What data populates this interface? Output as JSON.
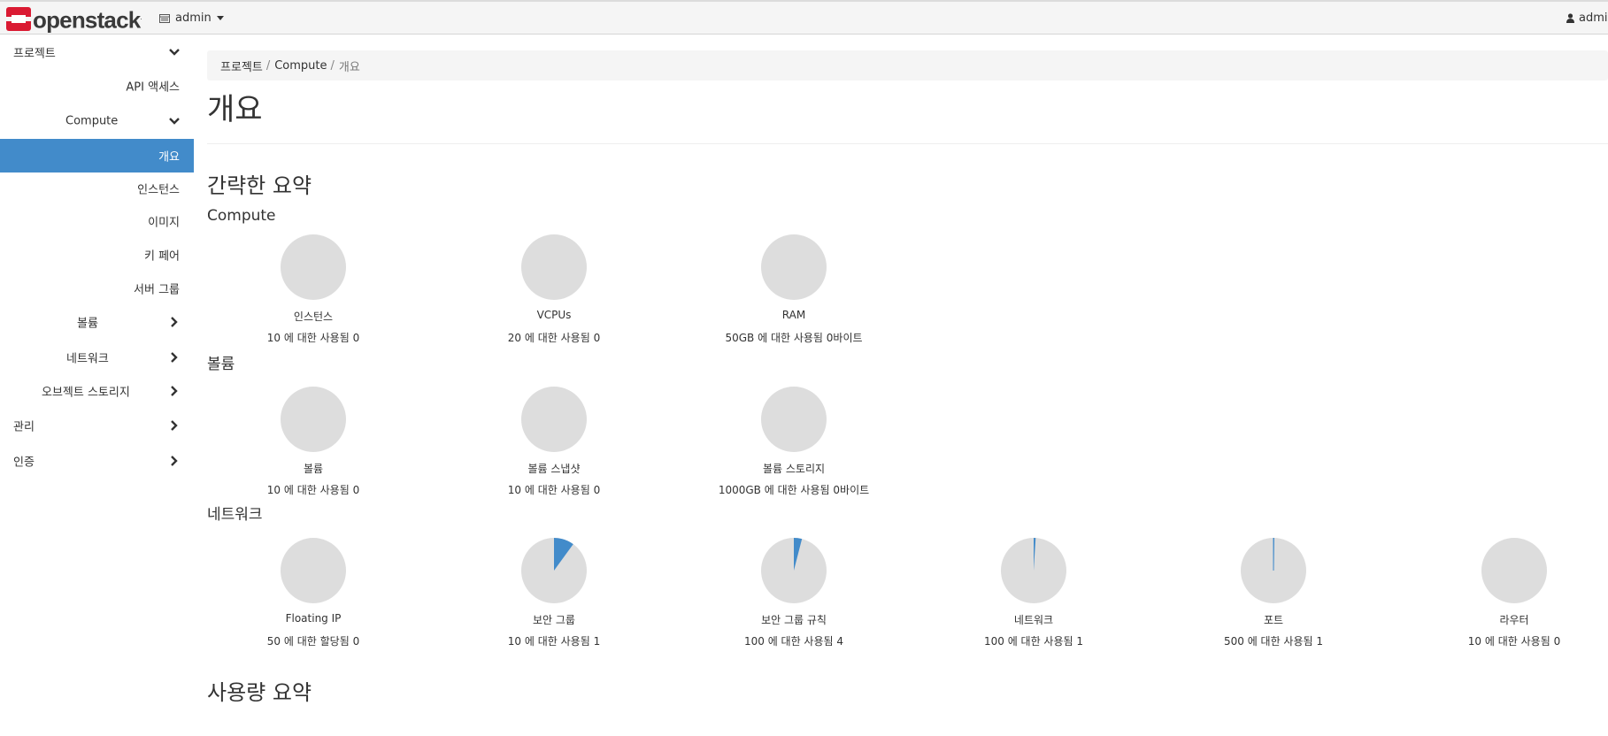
{
  "navbar": {
    "brand": "openstack",
    "brand_mark": ".",
    "project": "admin",
    "user": "admin"
  },
  "sidebar": {
    "items": [
      {
        "label": "프로젝트",
        "chevron": "down"
      },
      {
        "label": "API 액세스",
        "chevron": ""
      },
      {
        "label": "Compute",
        "chevron": "down"
      },
      {
        "label": "개요",
        "chevron": "",
        "active": true
      },
      {
        "label": "인스턴스",
        "chevron": ""
      },
      {
        "label": "이미지",
        "chevron": ""
      },
      {
        "label": "키 페어",
        "chevron": ""
      },
      {
        "label": "서버 그룹",
        "chevron": ""
      },
      {
        "label": "볼륨",
        "chevron": "right"
      },
      {
        "label": "네트워크",
        "chevron": "right"
      },
      {
        "label": "오브젝트 스토리지",
        "chevron": "right"
      },
      {
        "label": "관리",
        "chevron": "right"
      },
      {
        "label": "인증",
        "chevron": "right"
      }
    ]
  },
  "breadcrumb": [
    "프로젝트",
    "Compute",
    "개요"
  ],
  "breadcrumb_sep": "/",
  "page_title": "개요",
  "summary_heading": "간략한 요약",
  "sections": [
    {
      "heading": "Compute",
      "pies": [
        {
          "title": "인스턴스",
          "subtitle": "10 에 대한 사용됨 0",
          "used_fraction": 0
        },
        {
          "title": "VCPUs",
          "subtitle": "20 에 대한 사용됨 0",
          "used_fraction": 0
        },
        {
          "title": "RAM",
          "subtitle": "50GB 에 대한 사용됨 0바이트",
          "used_fraction": 0
        }
      ]
    },
    {
      "heading": "볼륨",
      "pies": [
        {
          "title": "볼륨",
          "subtitle": "10 에 대한 사용됨 0",
          "used_fraction": 0
        },
        {
          "title": "볼륨 스냅샷",
          "subtitle": "10 에 대한 사용됨 0",
          "used_fraction": 0
        },
        {
          "title": "볼륨 스토리지",
          "subtitle": "1000GB 에 대한 사용됨 0바이트",
          "used_fraction": 0
        }
      ]
    },
    {
      "heading": "네트워크",
      "pies": [
        {
          "title": "Floating IP",
          "subtitle": "50 에 대한 할당됨 0",
          "used_fraction": 0
        },
        {
          "title": "보안 그룹",
          "subtitle": "10 에 대한 사용됨 1",
          "used_fraction": 0.1
        },
        {
          "title": "보안 그룹 규칙",
          "subtitle": "100 에 대한 사용됨 4",
          "used_fraction": 0.04
        },
        {
          "title": "네트워크",
          "subtitle": "100 에 대한 사용됨 1",
          "used_fraction": 0.01
        },
        {
          "title": "포트",
          "subtitle": "500 에 대한 사용됨 1",
          "used_fraction": 0.002
        },
        {
          "title": "라우터",
          "subtitle": "10 에 대한 사용됨 0",
          "used_fraction": 0
        }
      ]
    }
  ],
  "usage_heading": "사용량 요약",
  "colors": {
    "accent": "#428bca",
    "pie_bg": "#dddddd",
    "logo_red": "#da1a32"
  }
}
